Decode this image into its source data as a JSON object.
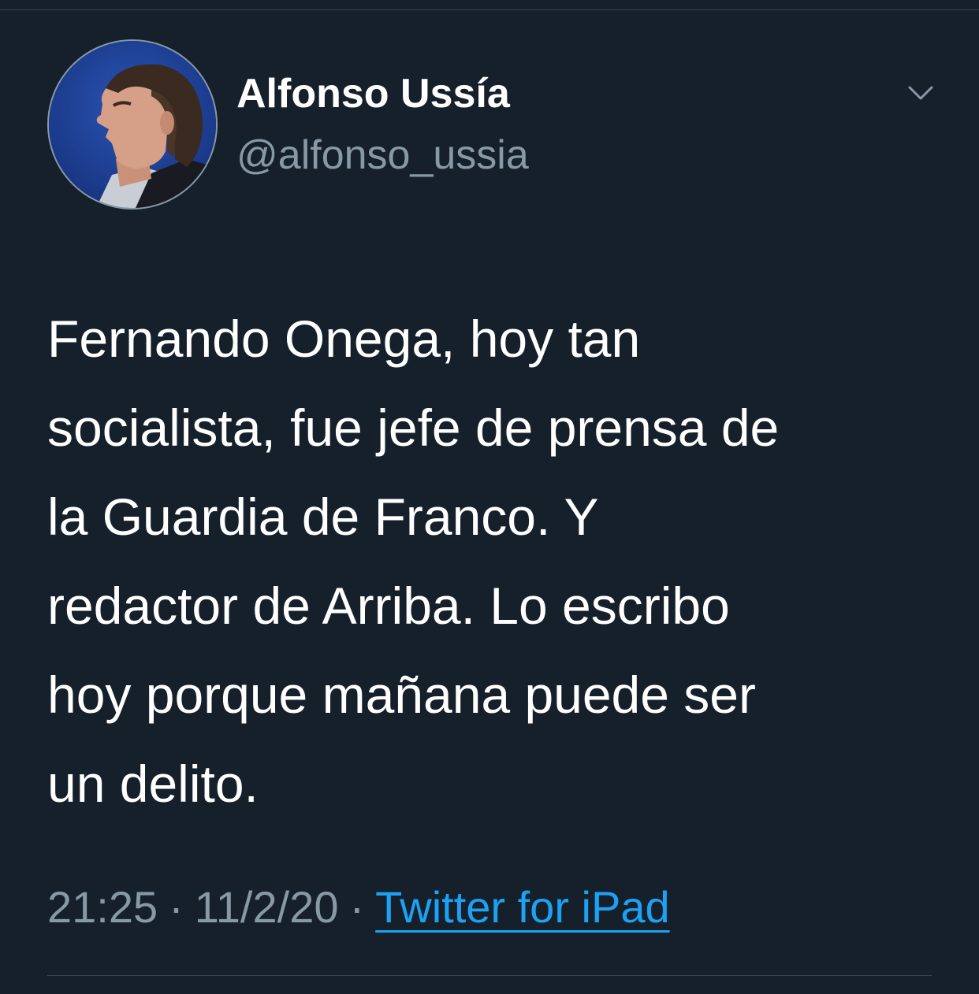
{
  "user": {
    "display_name": "Alfonso Ussía",
    "handle": "@alfonso_ussia"
  },
  "icons": {
    "menu": "chevron-down-icon",
    "avatar": "profile-photo"
  },
  "tweet": {
    "lines": [
      "Fernando Onega, hoy tan",
      "socialista, fue jefe de prensa de",
      "la Guardia de Franco. Y",
      "redactor de Arriba. Lo escribo",
      "hoy porque mañana puede ser",
      "un delito."
    ],
    "time": "21:25",
    "separator": "·",
    "date": "11/2/20",
    "source": "Twitter for iPad"
  },
  "colors": {
    "background": "#15202b",
    "text_primary": "#ffffff",
    "text_secondary": "#8899a6",
    "link": "#1da1f2",
    "divider": "#38444d"
  }
}
